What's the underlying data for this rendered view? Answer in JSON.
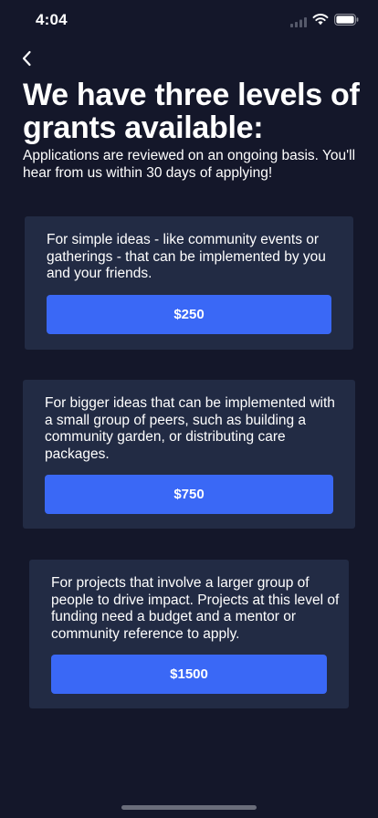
{
  "status_bar": {
    "time": "4:04"
  },
  "header": {
    "title": "We have three levels of grants available:",
    "subtitle": "Applications are reviewed on an ongoing basis. You'll hear from us within 30 days of applying!"
  },
  "tiers": [
    {
      "description": "For simple ideas - like community events or gatherings - that can be implemented by you and your friends.",
      "amount": "$250"
    },
    {
      "description": "For bigger ideas that can be implemented with a small group of peers, such as building a community garden, or distributing care packages.",
      "amount": "$750"
    },
    {
      "description": "For projects that involve a larger group of people to drive impact. Projects at this level of funding need a budget and a mentor or community reference to apply.",
      "amount": "$1500"
    }
  ],
  "colors": {
    "background": "#14172a",
    "card": "#222b44",
    "accent": "#3a68f6"
  },
  "icons": {
    "back": "chevron-left-icon",
    "signal": "cellular-signal-icon",
    "wifi": "wifi-icon",
    "battery": "battery-icon"
  }
}
